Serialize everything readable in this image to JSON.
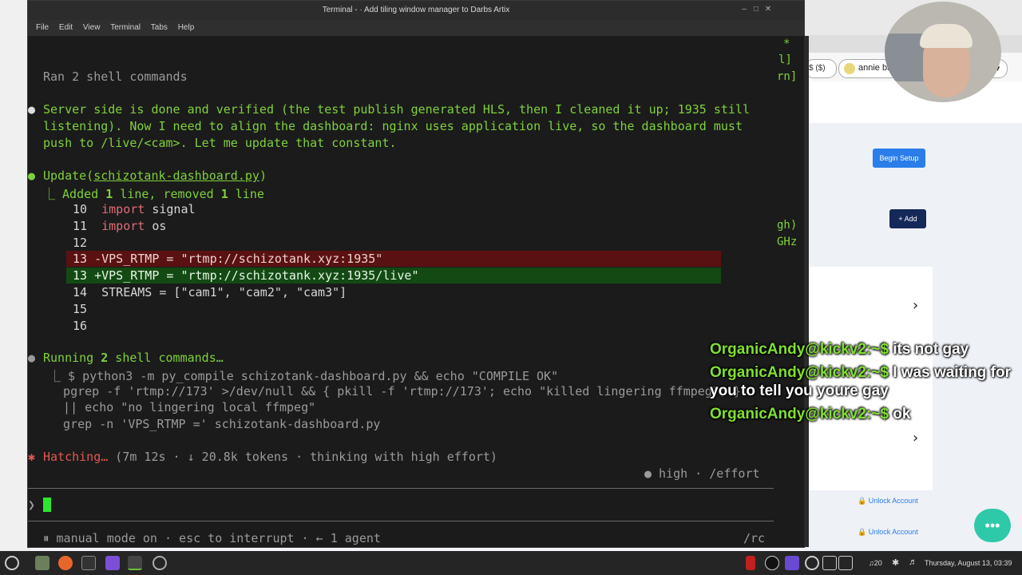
{
  "window": {
    "title": "Terminal - · Add tiling window manager to Darbs Artix",
    "menu": [
      "File",
      "Edit",
      "View",
      "Terminal",
      "Tabs",
      "Help"
    ]
  },
  "terminal": {
    "ran_header": "Ran 2 shell commands",
    "msg_lines": [
      "Server side is done and verified (the test publish generated HLS, then I cleaned it up; 1935 still",
      "listening). Now I need to align the dashboard: nginx uses application live, so the dashboard must",
      "push to /live/<cam>. Let me update that constant."
    ],
    "update_label": "Update(",
    "update_file": "schizotank-dashboard.py",
    "update_close": ")",
    "update_summary_pre": "Added ",
    "update_added": "1",
    "update_mid": " line, removed ",
    "update_removed": "1",
    "update_post": " line",
    "diff": {
      "l10": "10",
      "l10_kw": "import",
      "l10_rest": " signal",
      "l11": "11",
      "l11_kw": "import",
      "l11_rest": " os",
      "l12": "12",
      "l13a": "13 -VPS_RTMP = \"rtmp://schizotank.xyz:1935\"",
      "l13b": "13 +VPS_RTMP = \"rtmp://schizotank.xyz:1935/live\"",
      "l14": "14  STREAMS = [\"cam1\", \"cam2\", \"cam3\"]",
      "l15": "15",
      "l16": "16"
    },
    "running_pre": "Running ",
    "running_count": "2",
    "running_post": " shell commands…",
    "cmd_lines": [
      "⎿ $ python3 -m py_compile schizotank-dashboard.py && echo \"COMPILE OK\"",
      "  pgrep -f 'rtmp://173' >/dev/null && { pkill -f 'rtmp://173'; echo \"killed lingering ffmpeg\"; }",
      "  || echo \"no lingering local ffmpeg\"",
      "  grep -n 'VPS_RTMP =' schizotank-dashboard.py"
    ],
    "hatching_label": "Hatching…",
    "hatching_detail": " (7m 12s · ↓ 20.8k tokens · thinking with high effort)",
    "effort": "● high · /effort",
    "prompt_char": "❯",
    "status_line": "⏸ manual mode on · esc to interrupt · ← 1 agent",
    "status_right": "/rc",
    "side_fragments": [
      "*",
      "l]",
      "rn]",
      "gh)",
      "GHz"
    ]
  },
  "chat": [
    {
      "user": "OrganicAndy@kickv2:~$",
      "text": " its not gay"
    },
    {
      "user": "OrganicAndy@kickv2:~$",
      "text": " I was waiting for you to tell you youre gay"
    },
    {
      "user": "OrganicAndy@kickv2:~$",
      "text": " ok"
    }
  ],
  "background": {
    "user_name": "annie bannannie",
    "begin_setup": "Begin Setup",
    "add_button": "+ Add",
    "unlock": "Unlock Account",
    "currency": "$ ($)"
  },
  "taskbar": {
    "volume": "20",
    "datetime": "Thursday, August 13, 03:39"
  }
}
